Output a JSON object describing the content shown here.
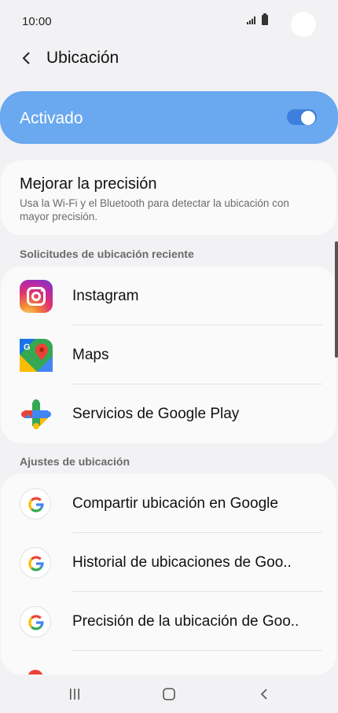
{
  "status": {
    "time": "10:00"
  },
  "header": {
    "title": "Ubicación"
  },
  "master_toggle": {
    "label": "Activado",
    "enabled": true,
    "accent_color": "#6aa8ef"
  },
  "accuracy": {
    "title": "Mejorar la precisión",
    "description": "Usa la Wi-Fi y el Bluetooth para detectar la ubicación con mayor precisión."
  },
  "recent": {
    "section_title": "Solicitudes de ubicación reciente",
    "items": [
      {
        "label": "Instagram",
        "icon": "instagram-icon"
      },
      {
        "label": "Maps",
        "icon": "google-maps-icon"
      },
      {
        "label": "Servicios de Google Play",
        "icon": "google-play-services-icon"
      }
    ]
  },
  "settings": {
    "section_title": "Ajustes de ubicación",
    "items": [
      {
        "label": "Compartir ubicación en Google",
        "icon": "google-g-icon"
      },
      {
        "label": "Historial de ubicaciones de Goo..",
        "icon": "google-g-icon"
      },
      {
        "label": "Precisión de la ubicación de Goo..",
        "icon": "google-g-icon"
      }
    ]
  },
  "nav": {
    "icons": [
      "recents-icon",
      "home-icon",
      "back-icon"
    ]
  }
}
